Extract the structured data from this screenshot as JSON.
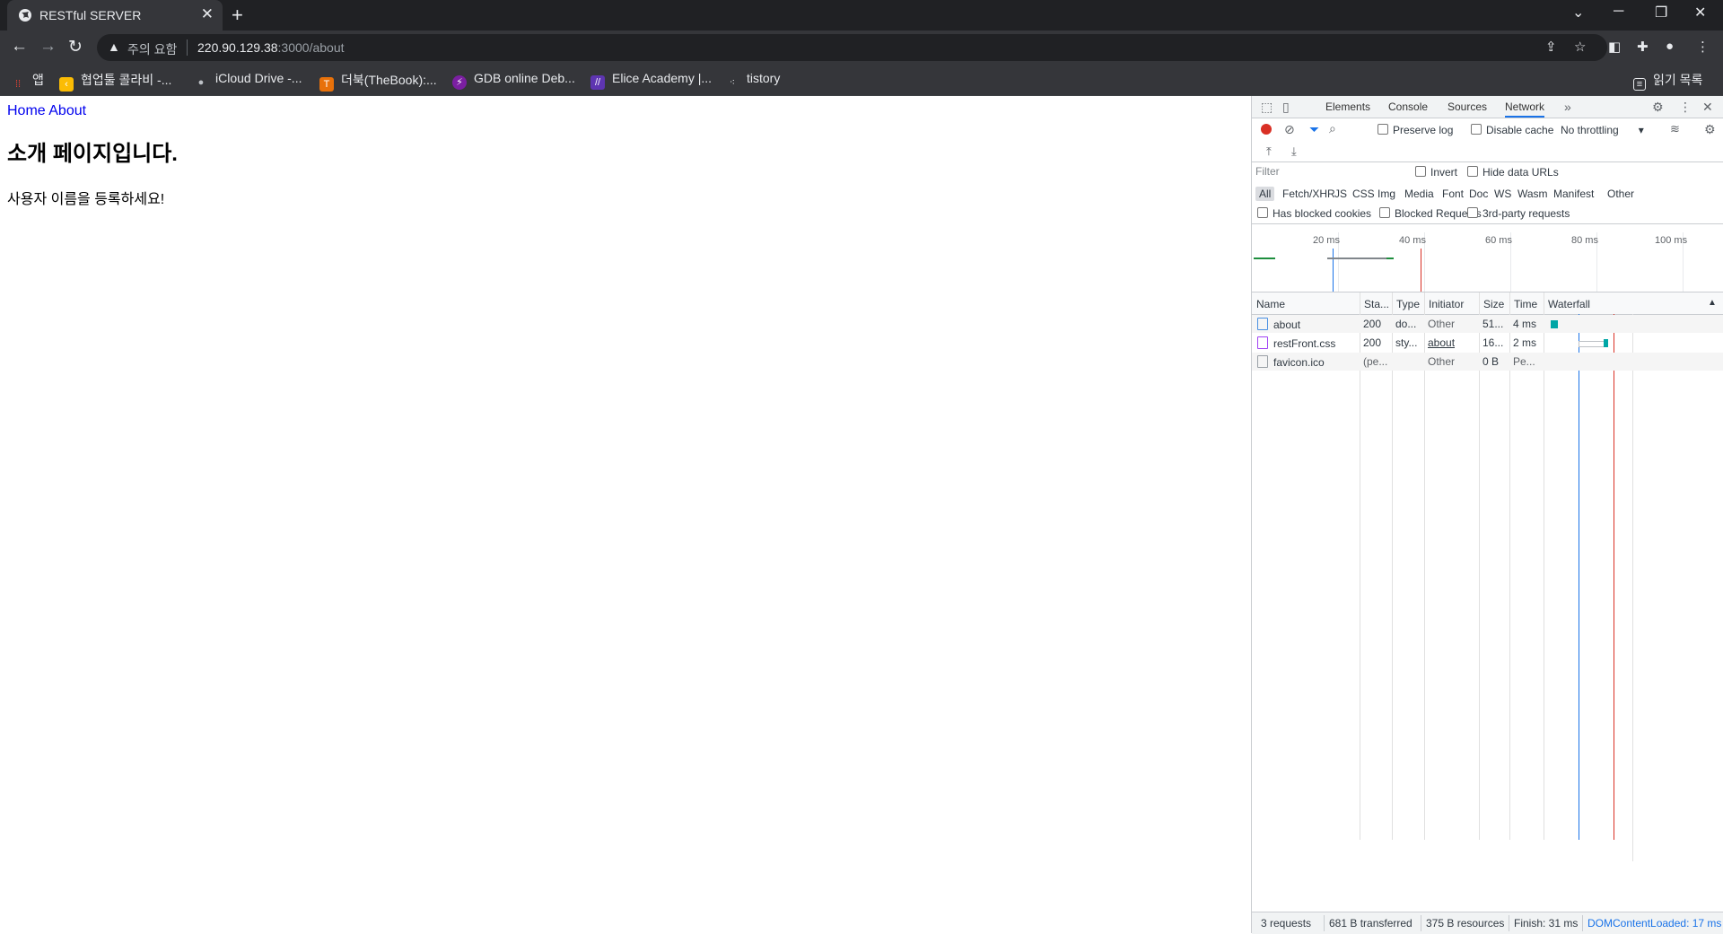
{
  "browser": {
    "tab_title": "RESTful SERVER",
    "security_label": "주의 요함",
    "url_host": "220.90.129.38",
    "url_rest": ":3000/about"
  },
  "bookmarks": [
    {
      "label": "앱",
      "color": "#ea4335"
    },
    {
      "label": "협업툴 콜라비 -...",
      "color": "#fbbc04"
    },
    {
      "label": "iCloud Drive -...",
      "color": "#9aa0a6"
    },
    {
      "label": "더북(TheBook):...",
      "color": "#e8710a"
    },
    {
      "label": "GDB online Deb...",
      "color": "#7b1fa2"
    },
    {
      "label": "Elice Academy |...",
      "color": "#5e35b1"
    },
    {
      "label": "tistory",
      "color": "#202124"
    }
  ],
  "reading_list": "읽기 목록",
  "page": {
    "nav_home": "Home",
    "nav_about": "About",
    "heading": "소개 페이지입니다.",
    "message": "사용자 이름을 등록하세요!"
  },
  "devtools": {
    "tabs": [
      "Elements",
      "Console",
      "Sources",
      "Network"
    ],
    "active_tab": "Network",
    "preserve_log": "Preserve log",
    "disable_cache": "Disable cache",
    "throttling": "No throttling",
    "filter_placeholder": "Filter",
    "invert": "Invert",
    "hide_data_urls": "Hide data URLs",
    "filter_types": [
      "All",
      "Fetch/XHR",
      "JS",
      "CSS",
      "Img",
      "Media",
      "Font",
      "Doc",
      "WS",
      "Wasm",
      "Manifest",
      "Other"
    ],
    "has_blocked_cookies": "Has blocked cookies",
    "blocked_requests": "Blocked Requests",
    "third_party": "3rd-party requests",
    "timeline_ticks": [
      "20 ms",
      "40 ms",
      "60 ms",
      "80 ms",
      "100 ms"
    ],
    "columns": [
      "Name",
      "Sta...",
      "Type",
      "Initiator",
      "Size",
      "Time",
      "Waterfall"
    ],
    "rows": [
      {
        "name": "about",
        "status": "200",
        "type": "do...",
        "initiator": "Other",
        "size": "51...",
        "time": "4 ms",
        "icon_color": "#4a90e2"
      },
      {
        "name": "restFront.css",
        "status": "200",
        "type": "sty...",
        "initiator": "about",
        "size": "16...",
        "time": "2 ms",
        "icon_color": "#a142f4"
      },
      {
        "name": "favicon.ico",
        "status": "(pe...",
        "type": "",
        "initiator": "Other",
        "size": "0 B",
        "time": "Pe...",
        "icon_color": "#9aa0a6"
      }
    ],
    "status": {
      "requests": "3 requests",
      "transferred": "681 B transferred",
      "resources": "375 B resources",
      "finish": "Finish: 31 ms",
      "dcl": "DOMContentLoaded: 17 ms"
    }
  }
}
